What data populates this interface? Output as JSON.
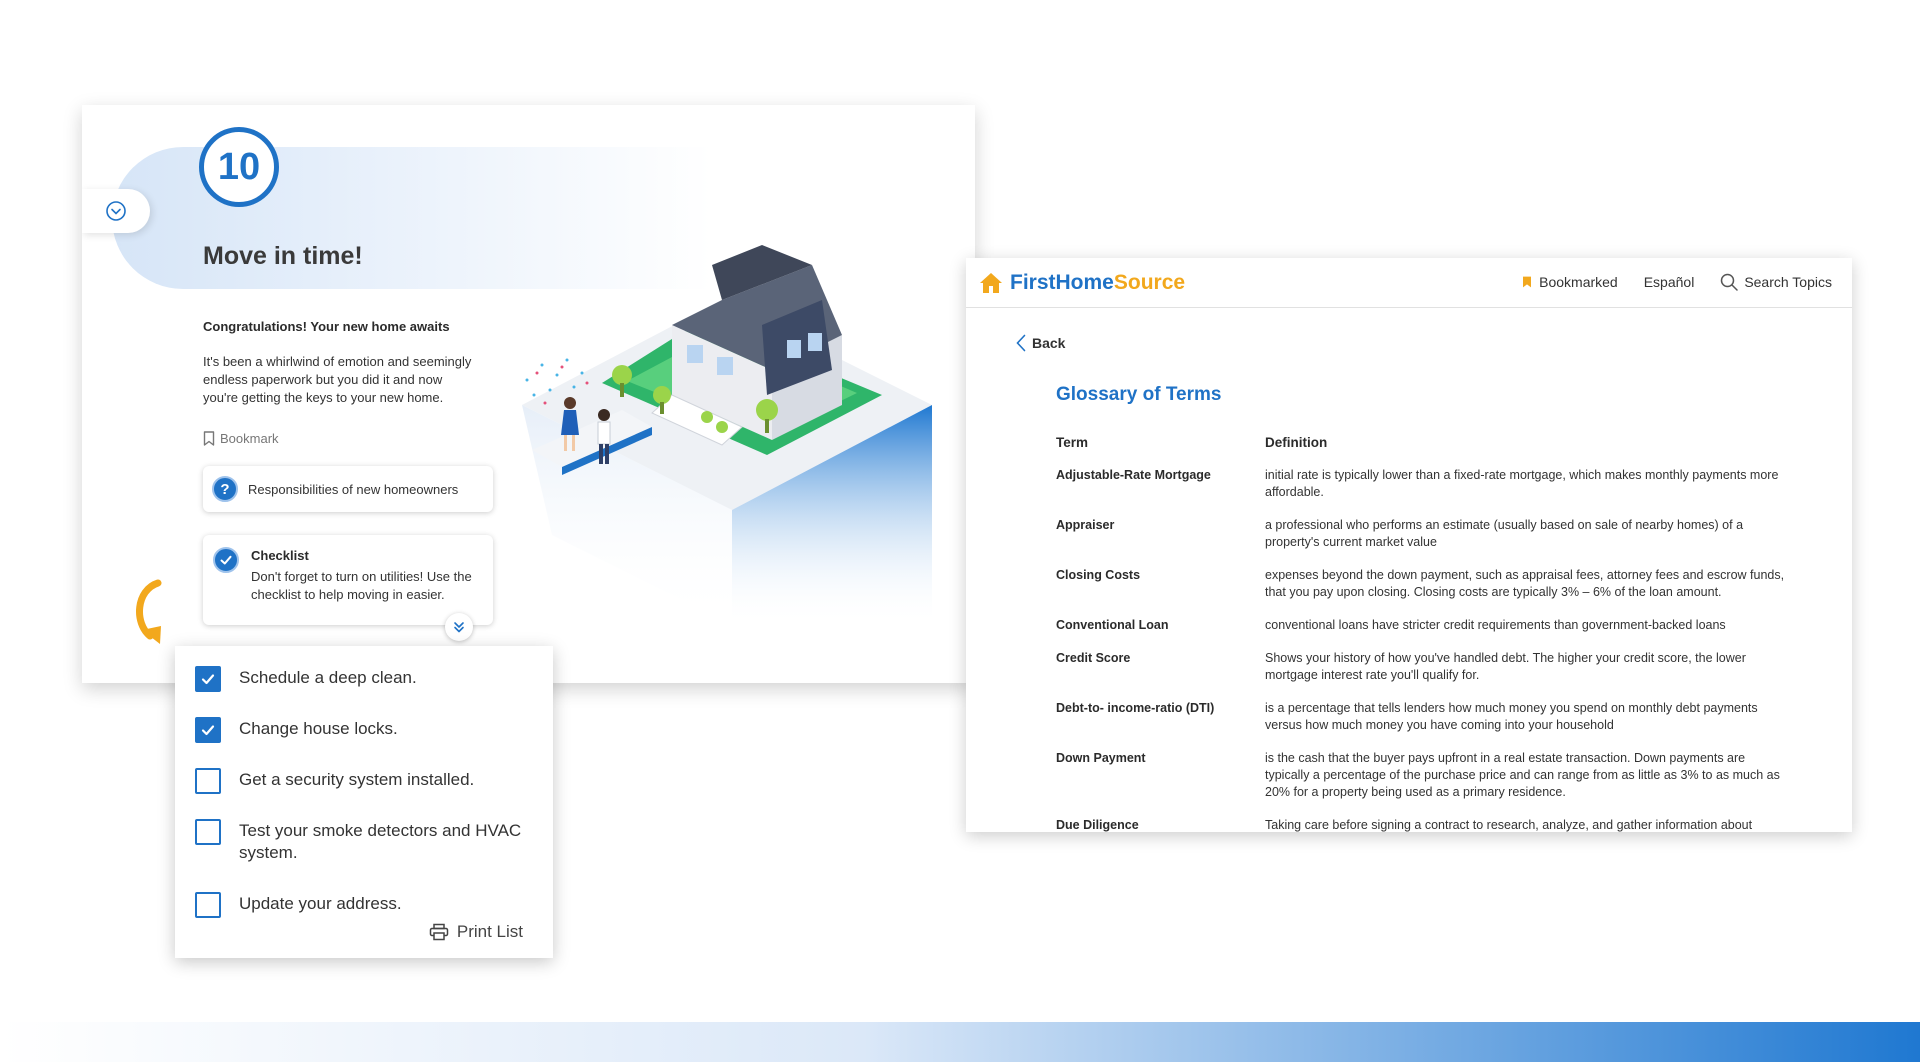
{
  "step": {
    "number": "10",
    "title": "Move in time!",
    "intro_heading": "Congratulations! Your new home awaits",
    "intro_text": "It's been a whirlwind of emotion and seemingly endless paperwork but you did it and now you're getting the keys to your new home.",
    "bookmark_label": "Bookmark",
    "responsibilities_label": "Responsibilities of new homeowners",
    "checklist_card": {
      "title": "Checklist",
      "text": "Don't forget to turn on utilities! Use the checklist to help moving in easier."
    }
  },
  "checklist": {
    "items": [
      {
        "label": "Schedule a deep clean.",
        "checked": true
      },
      {
        "label": "Change house locks.",
        "checked": true
      },
      {
        "label": "Get a security system installed.",
        "checked": false
      },
      {
        "label": "Test your smoke detectors and HVAC system.",
        "checked": false
      },
      {
        "label": "Update your address.",
        "checked": false
      }
    ],
    "print_label": "Print List"
  },
  "glossary": {
    "logo": {
      "part1": "FirstHome",
      "part2": "Source"
    },
    "nav": {
      "bookmarked": "Bookmarked",
      "language": "Español",
      "search": "Search Topics"
    },
    "back_label": "Back",
    "title": "Glossary of Terms",
    "columns": {
      "term": "Term",
      "definition": "Definition"
    },
    "rows": [
      {
        "term": "Adjustable-Rate Mortgage",
        "definition": "initial rate is typically lower than a fixed-rate mortgage, which makes monthly payments more affordable."
      },
      {
        "term": "Appraiser",
        "definition": "a professional who performs an estimate (usually based on sale of nearby homes) of a property's current market value"
      },
      {
        "term": "Closing Costs",
        "definition": "expenses beyond the down payment, such as appraisal fees, attorney fees and escrow funds, that you pay upon closing. Closing costs are typically 3% – 6% of the loan amount."
      },
      {
        "term": "Conventional Loan",
        "definition": "conventional loans have stricter credit requirements than government-backed loans"
      },
      {
        "term": "Credit Score",
        "definition": "Shows your history of how you've handled debt. The higher your credit score, the lower mortgage interest rate you'll qualify for."
      },
      {
        "term": "Debt-to- income-ratio (DTI)",
        "definition": "is a percentage that tells lenders how much money you spend on monthly debt payments versus how much money you have coming into your household"
      },
      {
        "term": "Down Payment",
        "definition": "is the cash that the buyer pays upfront in a real estate transaction. Down payments are typically a percentage of the purchase price and can range from as little as 3% to as much as 20% for a property being used as a primary residence."
      },
      {
        "term": "Due Diligence",
        "definition": "Taking care before signing a contract to research, analyze, and gather information about"
      }
    ]
  },
  "colors": {
    "brand_blue": "#1f72c6",
    "brand_orange": "#f2a81d"
  }
}
